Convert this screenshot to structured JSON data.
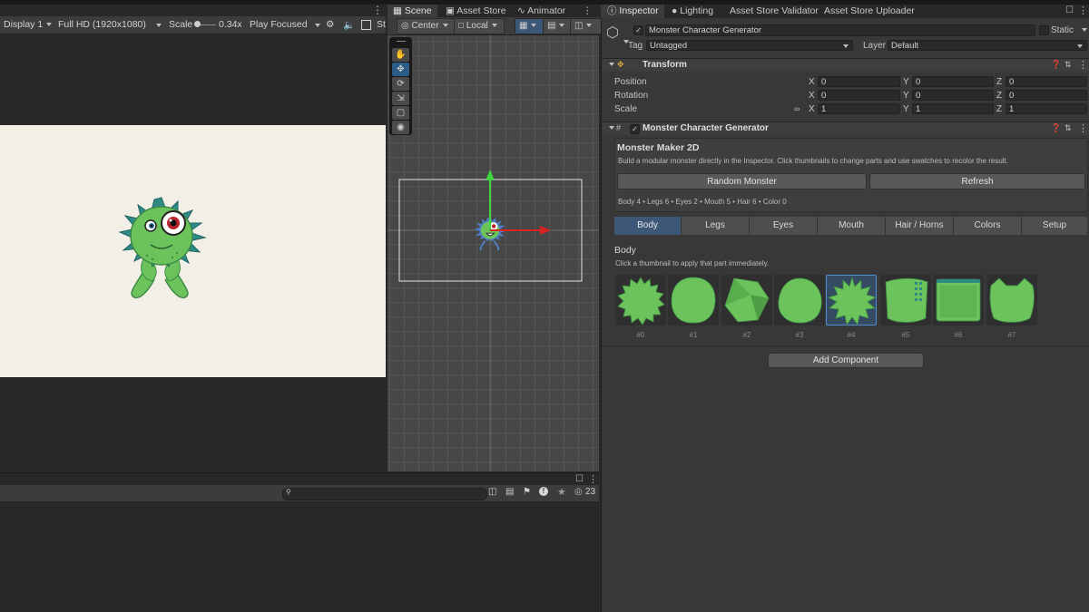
{
  "game": {
    "display": "Display 1",
    "resolution": "Full HD (1920x1080)",
    "scale_label": "Scale",
    "scale_value": "0.34x",
    "play_mode": "Play Focused",
    "stats_stub": "St"
  },
  "scene": {
    "tabs": [
      "Scene",
      "Asset Store",
      "Animator"
    ],
    "pivot": "Center",
    "space": "Local"
  },
  "bottom": {
    "visible_count": "23"
  },
  "inspector": {
    "tabs": [
      "Inspector",
      "Lighting",
      "Asset Store Validator",
      "Asset Store Uploader"
    ],
    "object_name": "Monster Character Generator",
    "static_label": "Static",
    "tag_label": "Tag",
    "tag_value": "Untagged",
    "layer_label": "Layer",
    "layer_value": "Default",
    "transform": {
      "title": "Transform",
      "rows": [
        {
          "label": "Position",
          "x": "0",
          "y": "0",
          "z": "0"
        },
        {
          "label": "Rotation",
          "x": "0",
          "y": "0",
          "z": "0"
        },
        {
          "label": "Scale",
          "x": "1",
          "y": "1",
          "z": "1"
        }
      ],
      "axis_x": "X",
      "axis_y": "Y",
      "axis_z": "Z"
    },
    "generator": {
      "title": "Monster Character Generator",
      "heading": "Monster Maker 2D",
      "description": "Build a modular monster directly in the Inspector. Click thumbnails to change parts and use swatches to recolor the result.",
      "random_button": "Random Monster",
      "refresh_button": "Refresh",
      "summary": "Body 4 • Legs 6 • Eyes 2 • Mouth 5 • Hair 6 • Color 0",
      "categories": [
        "Body",
        "Legs",
        "Eyes",
        "Mouth",
        "Hair / Horns",
        "Colors",
        "Setup"
      ],
      "section_title": "Body",
      "section_hint": "Click a thumbnail to apply that part immediately.",
      "thumbs": [
        "#0",
        "#1",
        "#2",
        "#3",
        "#4",
        "#5",
        "#6",
        "#7"
      ],
      "selected_index": 4
    },
    "add_component": "Add Component"
  },
  "colors": {
    "monster_green": "#6cc35c",
    "spike_teal": "#2f8a86",
    "accent_blue": "#3c5778"
  }
}
